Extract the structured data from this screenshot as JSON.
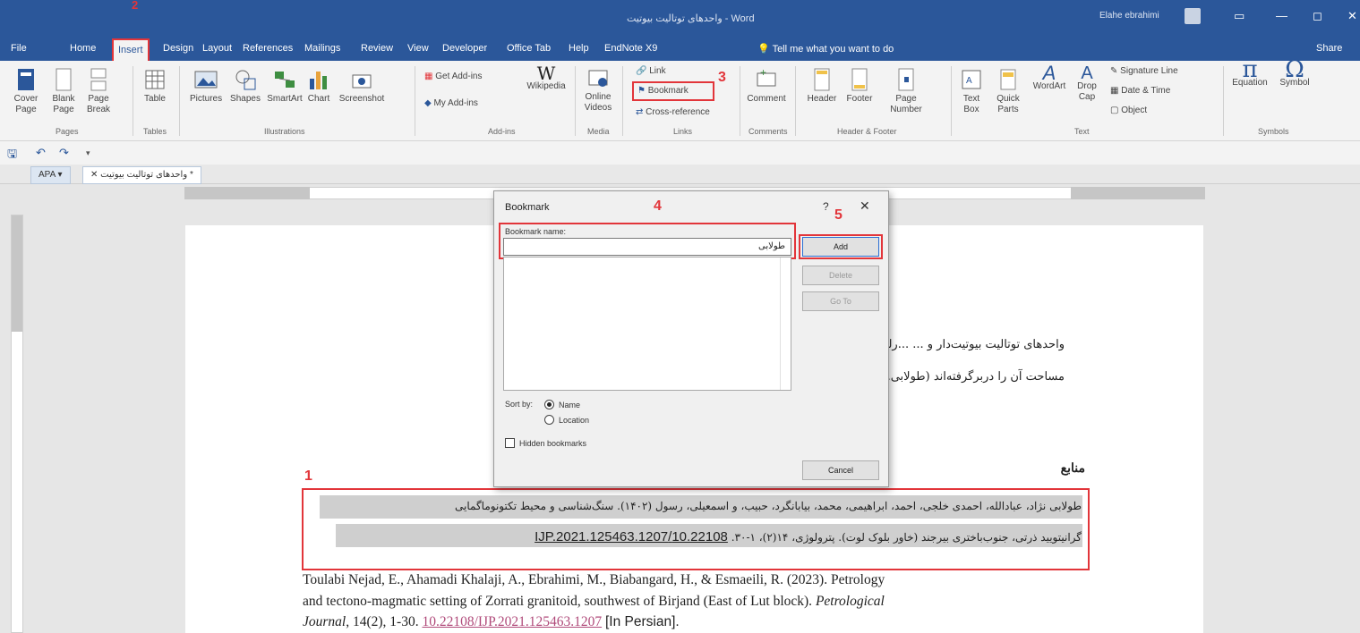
{
  "window": {
    "title": "واحدهای توتالیت بیوتیت - Word",
    "user": "Elahe ebrahimi",
    "controls": [
      "▭",
      "—",
      "◻",
      "✕"
    ]
  },
  "tabs": [
    "File",
    "Home",
    "Insert",
    "Design",
    "Layout",
    "References",
    "Mailings",
    "Review",
    "View",
    "Developer",
    "Office Tab",
    "Help",
    "EndNote X9"
  ],
  "tell_me": "Tell me what you want to do",
  "share": "Share",
  "ribbon": {
    "pages": {
      "label": "Pages",
      "cover": "Cover Page",
      "blank": "Blank Page",
      "break": "Page Break"
    },
    "tables": {
      "label": "Tables",
      "table": "Table"
    },
    "illustrations": {
      "label": "Illustrations",
      "items": [
        "Pictures",
        "Shapes",
        "SmartArt",
        "Chart",
        "Screenshot"
      ]
    },
    "addins": {
      "label": "Add-ins",
      "get": "Get Add-ins",
      "my": "My Add-ins",
      "wiki": "Wikipedia"
    },
    "media": {
      "label": "Media",
      "online": "Online Videos"
    },
    "links": {
      "label": "Links",
      "link": "Link",
      "bookmark": "Bookmark",
      "cross": "Cross-reference"
    },
    "comments": {
      "label": "Comments",
      "comment": "Comment"
    },
    "header_footer": {
      "label": "Header & Footer",
      "header": "Header",
      "footer": "Footer",
      "page_number": "Page Number"
    },
    "text": {
      "label": "Text",
      "textbox": "Text Box",
      "quick": "Quick Parts",
      "wordart": "WordArt",
      "dropcap": "Drop Cap",
      "signature": "Signature Line",
      "datetime": "Date & Time",
      "object": "Object"
    },
    "symbols": {
      "label": "Symbols",
      "equation": "Equation",
      "symbol": "Symbol"
    }
  },
  "doctabs": {
    "first": "APA",
    "second": "* واحدهای توتالیت بیوتیت"
  },
  "annotations": [
    "2",
    "3",
    "4",
    "5",
    "1"
  ],
  "document": {
    "para1_line1": "واحدهای توتالیت بیوتیت‌دار و ...                                                ...رلی هستند که بخش بزرگی از",
    "para1_line2": "مساحت آن را دربرگرفته‌اند (طولابی...",
    "heading": "منابع",
    "ref_fa_line1": "طولابی نژاد، عبادالله، احمدی خلجی، احمد، ابراهیمی، محمد، بیابانگرد، حبیب، و اسمعیلی، رسول (۱۴۰۲). سنگ‌شناسی و محیط تکتونوماگمایی",
    "ref_fa_line2": "گرانیتویید ذرتی، جنوب‌باختری بیرجند (خاور بلوک لوت). پترولوژی، ۱۴(۲)، ۱-۳۰.",
    "ref_fa_doi": "10.22108/IJP.2021.125463.1207",
    "ref_en_line1": "Toulabi Nejad, E., Ahamadi Khalaji, A., Ebrahimi, M., Biabangard, H., & Esmaeili, R. (2023). Petrology",
    "ref_en_line2": "and tectono-magmatic setting of Zorrati granitoid, southwest of Birjand (East of Lut block).",
    "ref_en_journal": "Petrological",
    "ref_en_line3_journal": "Journal",
    "ref_en_line3_vol": ", 14(2), 1-30.",
    "ref_en_doi": "10.22108/IJP.2021.125463.1207",
    "ref_en_note": "[In Persian]."
  },
  "dialog": {
    "title": "Bookmark",
    "help": "?",
    "close": "✕",
    "name_label": "Bookmark name:",
    "name_value": "طولابی",
    "buttons": {
      "add": "Add",
      "delete": "Delete",
      "goto": "Go To",
      "cancel": "Cancel"
    },
    "sort_label": "Sort by:",
    "sort_name": "Name",
    "sort_location": "Location",
    "hidden": "Hidden bookmarks"
  }
}
